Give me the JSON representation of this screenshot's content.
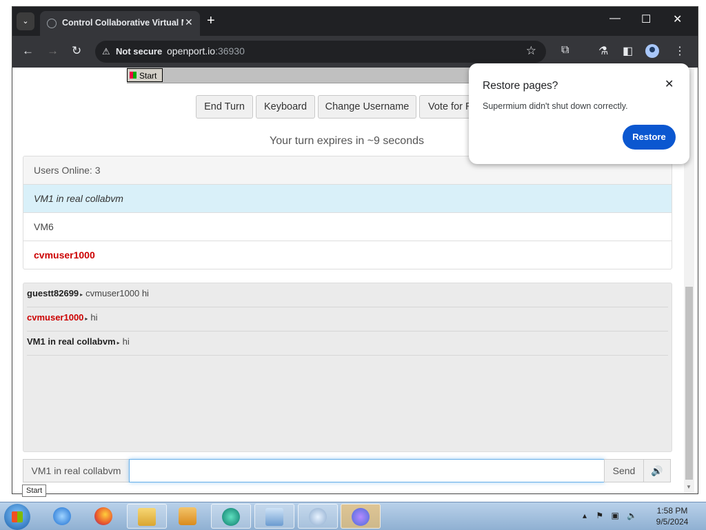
{
  "browser": {
    "tab_title": "Control Collaborative Virtual M",
    "not_secure": "Not secure",
    "url_host": "openport.io",
    "url_port": ":36930"
  },
  "vm": {
    "start_label": "Start"
  },
  "page": {
    "buttons": [
      "End Turn",
      "Keyboard",
      "Change Username",
      "Vote for R"
    ],
    "turn_message": "Your turn expires in ~9 seconds",
    "users_header": "Users Online: 3",
    "users": [
      "VM1 in real collabvm",
      "VM6",
      "cvmuser1000"
    ],
    "chat": [
      {
        "user": "guestt82699",
        "text": "cvmuser1000 hi"
      },
      {
        "user": "cvmuser1000",
        "text": "hi"
      },
      {
        "user": "VM1 in real collabvm",
        "text": "hi"
      }
    ],
    "username_addon": "VM1 in real collabvm",
    "chat_input_value": "",
    "send_label": "Send",
    "sound_icon": "speaker-icon"
  },
  "popup": {
    "title": "Restore pages?",
    "text": "Supermium didn't shut down correctly.",
    "button": "Restore"
  },
  "tooltip": "Start",
  "taskbar": {
    "time": "1:58 PM",
    "date": "9/5/2024"
  },
  "colors": {
    "accent_blue": "#0b57d0",
    "user_red": "#cc0000",
    "active_row": "#d9f0f9"
  }
}
